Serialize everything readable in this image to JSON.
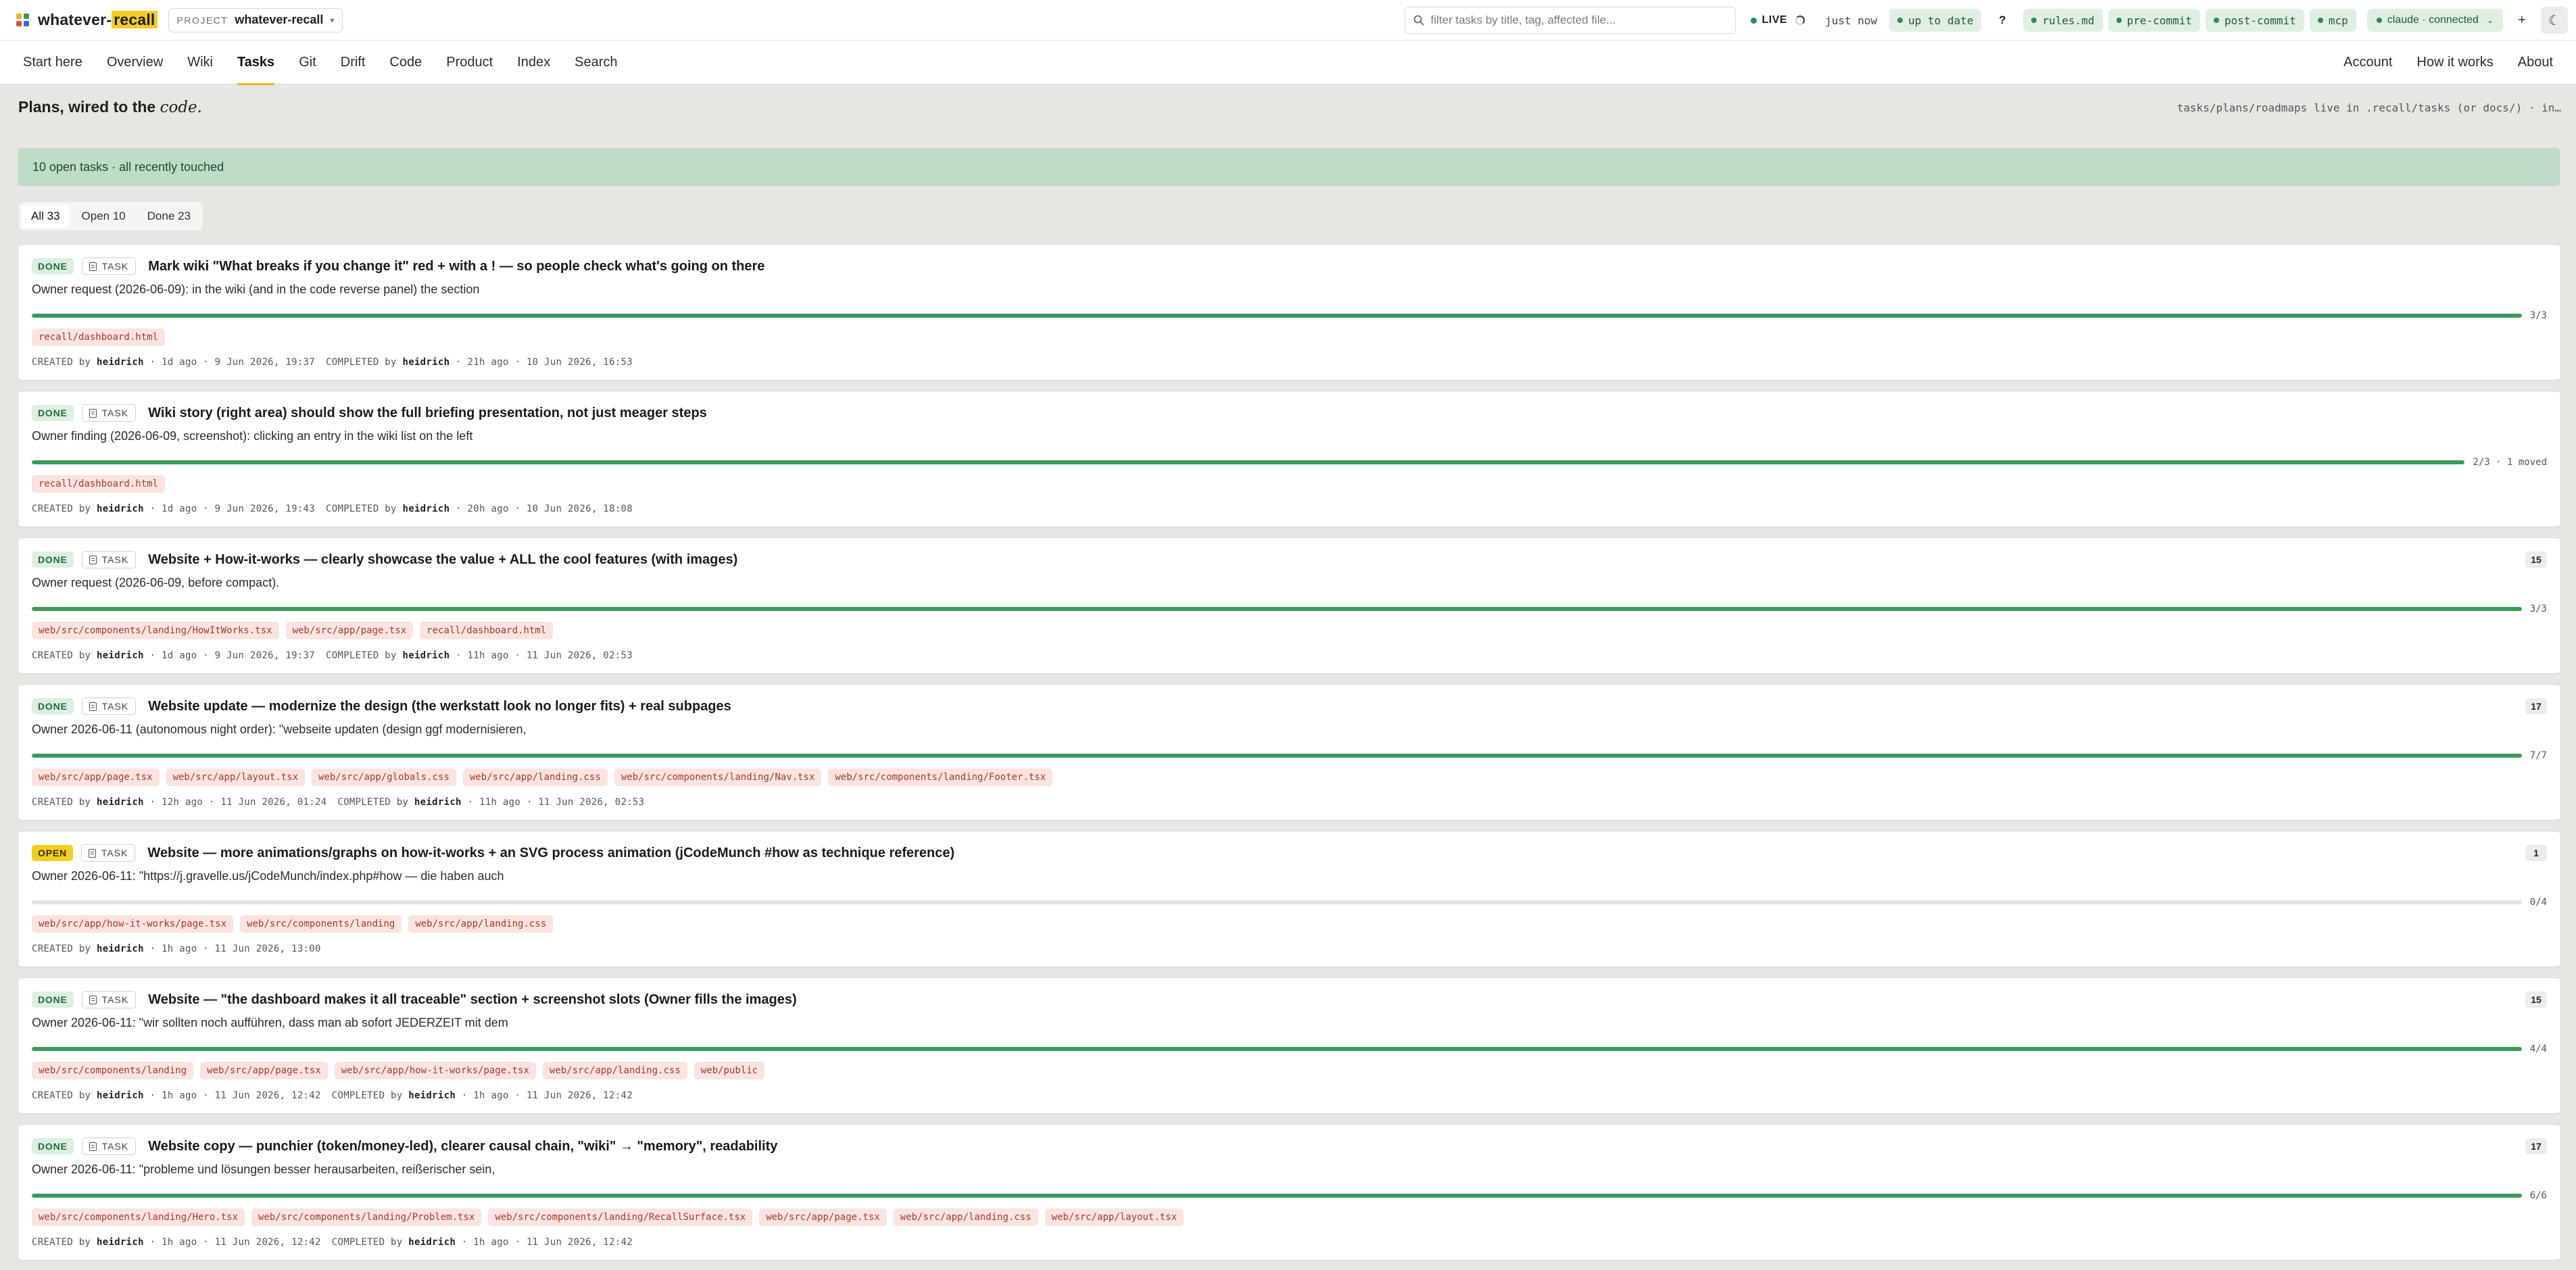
{
  "app": {
    "name_plain": "whatever-",
    "name_highlight": "recall",
    "project_label": "PROJECT",
    "project_name": "whatever-recall",
    "logo_colors": [
      "#e8b820",
      "#3c9a5a",
      "#d2553a",
      "#2f6fba"
    ]
  },
  "header": {
    "search_placeholder": "filter tasks by title, tag, affected file...",
    "live_label": "LIVE",
    "updated": "just now",
    "chips": [
      "up to date",
      "rules.md",
      "pre-commit",
      "post-commit",
      "mcp"
    ],
    "help": "?",
    "claude_status": "claude · connected",
    "plus_icon": "+",
    "theme_icon": "☾"
  },
  "nav": {
    "items": [
      "Start here",
      "Overview",
      "Wiki",
      "Tasks",
      "Git",
      "Drift",
      "Code",
      "Product",
      "Index",
      "Search"
    ],
    "right": [
      "Account",
      "How it works",
      "About"
    ]
  },
  "page": {
    "title_plain": "Plans, wired to the ",
    "title_italic": "code.",
    "hint": "tasks/plans/roadmaps live in .recall/tasks (or docs/) · in…",
    "banner": "10 open tasks · all recently touched",
    "filters": [
      "All 33",
      "Open 10",
      "Done 23"
    ]
  },
  "kind_label": "TASK",
  "tasks": [
    {
      "status": "DONE",
      "title": "Mark wiki \"What breaks if you change it\" red + with a ! — so people check what's going on there",
      "description": "Owner request (2026-06-09): in the wiki (and in the code reverse panel) the section",
      "progress": 1.0,
      "progress_label": "3/3",
      "count": "",
      "files": [
        "recall/dashboard.html"
      ],
      "created_by": "heidrich",
      "created_when": "1d ago · 9 Jun 2026, 19:37",
      "completed_by": "heidrich",
      "completed_when": "21h ago · 10 Jun 2026, 16:53"
    },
    {
      "status": "DONE",
      "title": "Wiki story (right area) should show the full briefing presentation, not just meager steps",
      "description": "Owner finding (2026-06-09, screenshot): clicking an entry in the wiki list on the left",
      "progress": 1.0,
      "progress_label": "2/3 · 1 moved",
      "count": "",
      "files": [
        "recall/dashboard.html"
      ],
      "created_by": "heidrich",
      "created_when": "1d ago · 9 Jun 2026, 19:43",
      "completed_by": "heidrich",
      "completed_when": "20h ago · 10 Jun 2026, 18:08"
    },
    {
      "status": "DONE",
      "title": "Website + How-it-works — clearly showcase the value + ALL the cool features (with images)",
      "description": "Owner request (2026-06-09, before compact).",
      "progress": 1.0,
      "progress_label": "3/3",
      "count": "15",
      "files": [
        "web/src/components/landing/HowItWorks.tsx",
        "web/src/app/page.tsx",
        "recall/dashboard.html"
      ],
      "created_by": "heidrich",
      "created_when": "1d ago · 9 Jun 2026, 19:37",
      "completed_by": "heidrich",
      "completed_when": "11h ago · 11 Jun 2026, 02:53"
    },
    {
      "status": "DONE",
      "title": "Website update — modernize the design (the werkstatt look no longer fits) + real subpages",
      "description": "Owner 2026-06-11 (autonomous night order): \"webseite updaten (design ggf modernisieren,",
      "progress": 1.0,
      "progress_label": "7/7",
      "count": "17",
      "files": [
        "web/src/app/page.tsx",
        "web/src/app/layout.tsx",
        "web/src/app/globals.css",
        "web/src/app/landing.css",
        "web/src/components/landing/Nav.tsx",
        "web/src/components/landing/Footer.tsx"
      ],
      "created_by": "heidrich",
      "created_when": "12h ago · 11 Jun 2026, 01:24",
      "completed_by": "heidrich",
      "completed_when": "11h ago · 11 Jun 2026, 02:53"
    },
    {
      "status": "OPEN",
      "title": "Website — more animations/graphs on how-it-works + an SVG process animation (jCodeMunch #how as technique reference)",
      "description": "Owner 2026-06-11: \"https://j.gravelle.us/jCodeMunch/index.php#how — die haben auch",
      "progress": 0.0,
      "progress_label": "0/4",
      "count": "1",
      "files": [
        "web/src/app/how-it-works/page.tsx",
        "web/src/components/landing",
        "web/src/app/landing.css"
      ],
      "created_by": "heidrich",
      "created_when": "1h ago · 11 Jun 2026, 13:00",
      "completed_by": "",
      "completed_when": ""
    },
    {
      "status": "DONE",
      "title": "Website — \"the dashboard makes it all traceable\" section + screenshot slots (Owner fills the images)",
      "description": "Owner 2026-06-11: \"wir sollten noch aufführen, dass man ab sofort JEDERZEIT mit dem",
      "progress": 1.0,
      "progress_label": "4/4",
      "count": "15",
      "files": [
        "web/src/components/landing",
        "web/src/app/page.tsx",
        "web/src/app/how-it-works/page.tsx",
        "web/src/app/landing.css",
        "web/public"
      ],
      "created_by": "heidrich",
      "created_when": "1h ago · 11 Jun 2026, 12:42",
      "completed_by": "heidrich",
      "completed_when": "1h ago · 11 Jun 2026, 12:42"
    },
    {
      "status": "DONE",
      "title": "Website copy — punchier (token/money-led), clearer causal chain, \"wiki\" → \"memory\", readability",
      "description": "Owner 2026-06-11: \"probleme und lösungen besser herausarbeiten, reißerischer sein,",
      "progress": 1.0,
      "progress_label": "6/6",
      "count": "17",
      "files": [
        "web/src/components/landing/Hero.tsx",
        "web/src/components/landing/Problem.tsx",
        "web/src/components/landing/RecallSurface.tsx",
        "web/src/app/page.tsx",
        "web/src/app/landing.css",
        "web/src/app/layout.tsx"
      ],
      "created_by": "heidrich",
      "created_when": "1h ago · 11 Jun 2026, 12:42",
      "completed_by": "heidrich",
      "completed_when": "1h ago · 11 Jun 2026, 12:42"
    }
  ]
}
